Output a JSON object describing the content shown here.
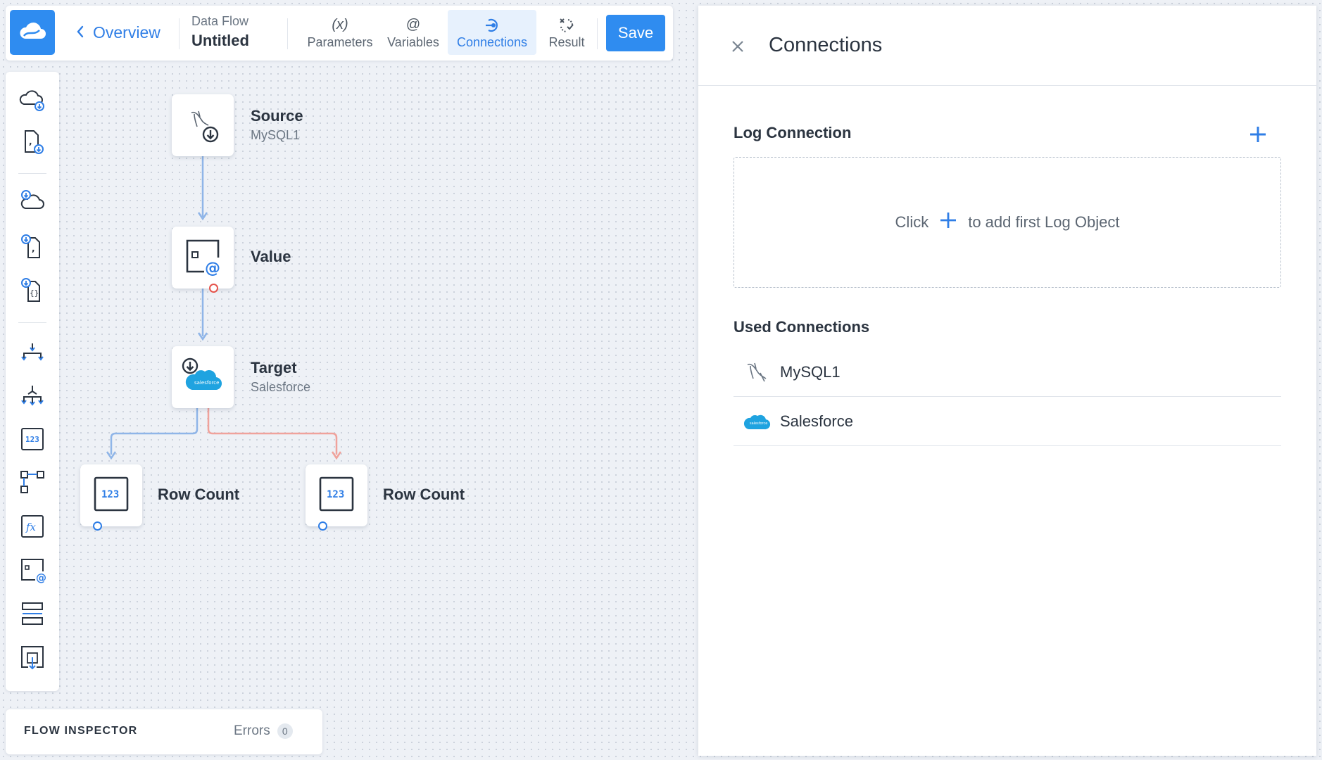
{
  "toolbar": {
    "back_label": "Overview",
    "doc_kind": "Data Flow",
    "doc_name": "Untitled",
    "tabs": [
      {
        "label": "Parameters",
        "icon": "(x)"
      },
      {
        "label": "Variables",
        "icon": "@"
      },
      {
        "label": "Connections",
        "icon": "connections-icon"
      },
      {
        "label": "Result",
        "icon": "result-icon"
      }
    ],
    "active_tab": "Connections",
    "save_label": "Save"
  },
  "palette": {
    "items": [
      "cloud-source-icon",
      "file-source-icon",
      "cloud-lookup-icon",
      "csv-lookup-icon",
      "json-lookup-icon",
      "split-icon",
      "merge-icon",
      "row-count-icon",
      "conditional-split-icon",
      "expression-icon",
      "value-icon",
      "buffer-icon",
      "file-target-icon"
    ]
  },
  "flow": {
    "nodes": [
      {
        "title": "Source",
        "subtitle": "MySQL1"
      },
      {
        "title": "Value",
        "subtitle": ""
      },
      {
        "title": "Target",
        "subtitle": "Salesforce"
      },
      {
        "title": "Row Count",
        "subtitle": ""
      },
      {
        "title": "Row Count",
        "subtitle": ""
      }
    ],
    "salesforce_mini_label": "salesforce"
  },
  "inspector": {
    "title": "FLOW INSPECTOR",
    "errors_label": "Errors",
    "errors_count": "0"
  },
  "panel": {
    "title": "Connections",
    "log_section_title": "Log Connection",
    "log_empty_prefix": "Click",
    "log_empty_suffix": "to add first Log Object",
    "used_section_title": "Used Connections",
    "used_connections": [
      {
        "name": "MySQL1",
        "icon": "mysql-icon"
      },
      {
        "name": "Salesforce",
        "icon": "salesforce-icon"
      }
    ]
  },
  "colors": {
    "accent": "#2f8cf0",
    "link": "#2f7ee6",
    "error": "#e5534b",
    "salesforce": "#1fa3e0"
  }
}
